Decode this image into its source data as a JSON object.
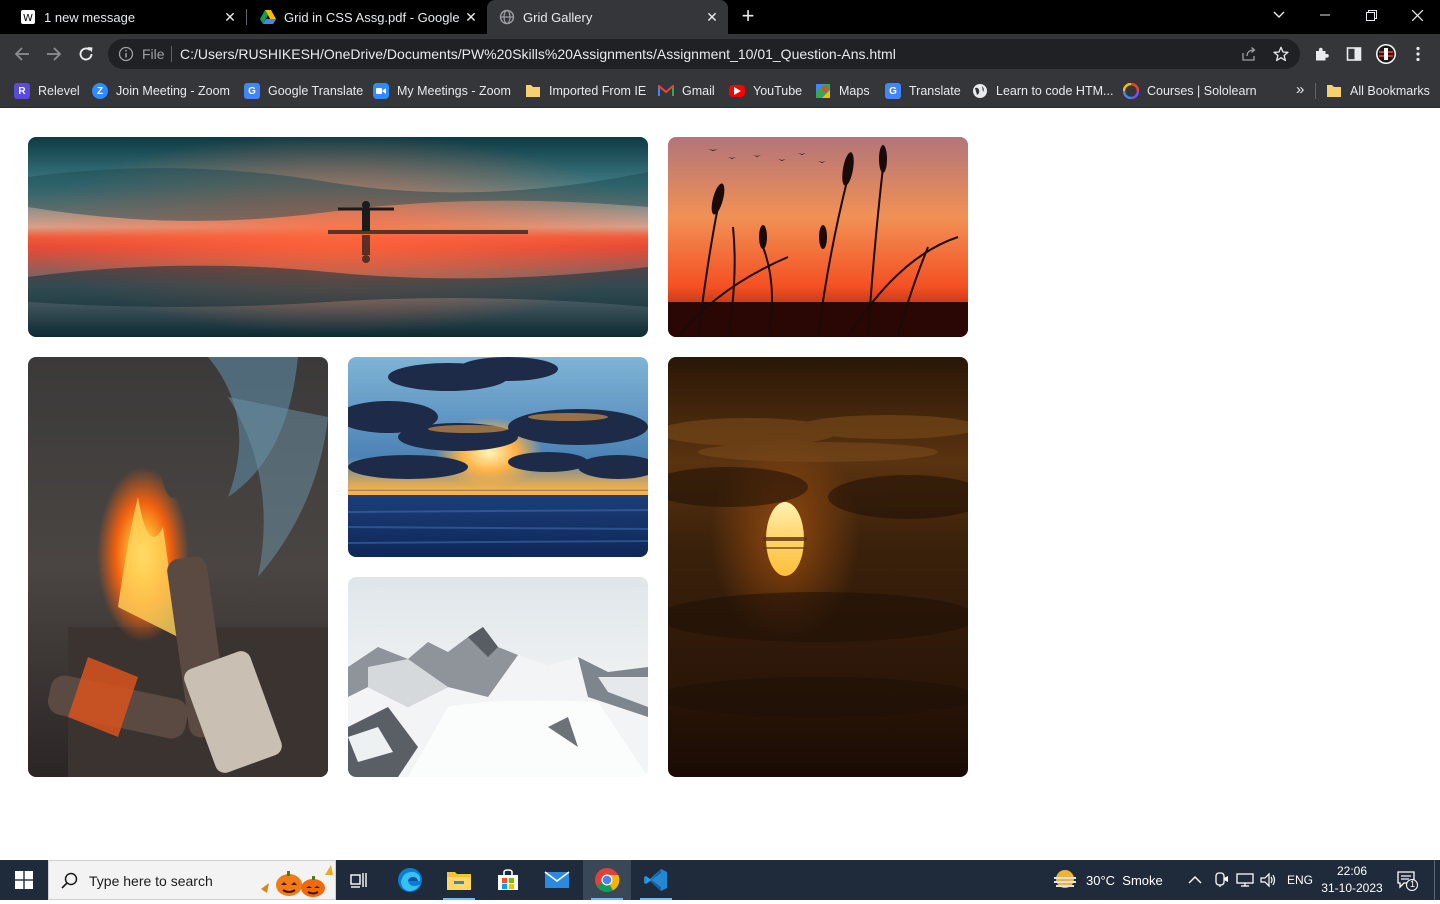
{
  "browser": {
    "tabs": [
      {
        "title": "1 new message",
        "active": false
      },
      {
        "title": "Grid in CSS Assg.pdf - Google D",
        "active": false
      },
      {
        "title": "Grid Gallery",
        "active": true
      }
    ],
    "omnibox": {
      "scheme": "File",
      "url": "C:/Users/RUSHIKESH/OneDrive/Documents/PW%20Skills%20Assignments/Assignment_10/01_Question-Ans.html"
    },
    "bookmarks": [
      {
        "label": "Relevel",
        "icon": "relevel-icon",
        "color": "#5b4bdb"
      },
      {
        "label": "Join Meeting - Zoom",
        "icon": "zoom-icon",
        "color": "#2d8cff"
      },
      {
        "label": "Google Translate",
        "icon": "google-translate-icon",
        "color": "#4285f4"
      },
      {
        "label": "My Meetings - Zoom",
        "icon": "zoom-video-icon",
        "color": "#2d8cff"
      },
      {
        "label": "Imported From IE",
        "icon": "folder-icon",
        "color": "#f4d06f"
      },
      {
        "label": "Gmail",
        "icon": "gmail-icon",
        "color": "#ea4335"
      },
      {
        "label": "YouTube",
        "icon": "youtube-icon",
        "color": "#ff0000"
      },
      {
        "label": "Maps",
        "icon": "maps-icon",
        "color": "#34a853"
      },
      {
        "label": "Translate",
        "icon": "translate-icon",
        "color": "#4285f4"
      },
      {
        "label": "Learn to code HTM...",
        "icon": "globe-icon",
        "color": "#e8eaed"
      },
      {
        "label": "Courses | Sololearn",
        "icon": "sololearn-icon",
        "color": "#7c4dff"
      }
    ],
    "more_bookmarks": "»",
    "all_bookmarks": "All Bookmarks"
  },
  "gallery": {
    "images": [
      {
        "subject": "sunset-reflection-person"
      },
      {
        "subject": "reeds-sunset-birds"
      },
      {
        "subject": "campfire"
      },
      {
        "subject": "ocean-sunset-clouds"
      },
      {
        "subject": "sun-behind-clouds"
      },
      {
        "subject": "snowy-mountains"
      }
    ]
  },
  "taskbar": {
    "search_placeholder": "Type here to search",
    "weather": "30°C  Smoke",
    "language": "ENG",
    "time": "22:06",
    "date": "31-10-2023",
    "notifications": "1"
  },
  "colors": {
    "tabstrip": "#000000",
    "toolbar": "#35363a",
    "taskbar": "#1f2b3a"
  }
}
